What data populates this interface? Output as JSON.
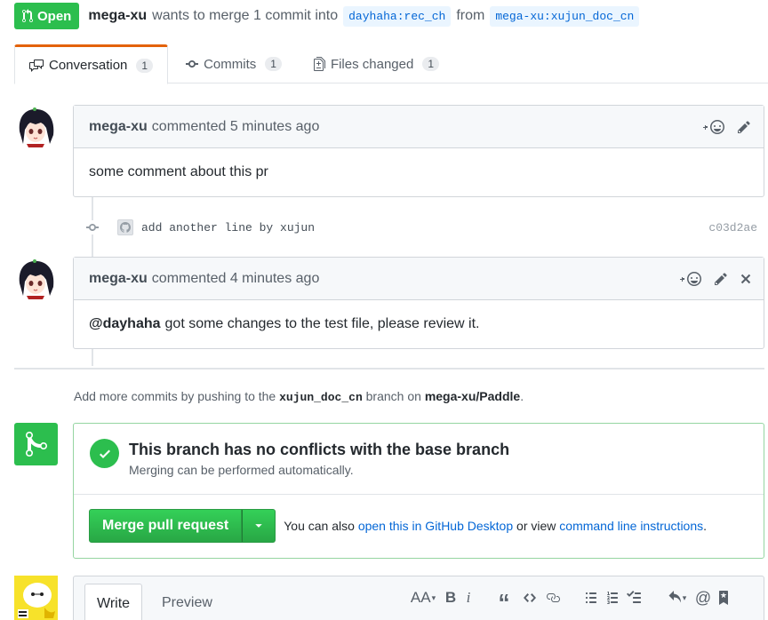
{
  "header": {
    "state_label": "Open",
    "author": "mega-xu",
    "action_text": "wants to merge 1 commit into",
    "base_branch": "dayhaha:rec_ch",
    "from_text": "from",
    "head_branch": "mega-xu:xujun_doc_cn"
  },
  "tabs": [
    {
      "label": "Conversation",
      "count": "1",
      "icon": "comment-discussion-icon"
    },
    {
      "label": "Commits",
      "count": "1",
      "icon": "git-commit-icon"
    },
    {
      "label": "Files changed",
      "count": "1",
      "icon": "diff-icon"
    }
  ],
  "comments": [
    {
      "author": "mega-xu",
      "meta": "commented 5 minutes ago",
      "body": "some comment about this pr"
    },
    {
      "author": "mega-xu",
      "meta": "commented 4 minutes ago",
      "mention": "@dayhaha",
      "body": "got some changes to the test file, please review it."
    }
  ],
  "commit": {
    "message": "add another line by xujun",
    "sha": "c03d2ae"
  },
  "push_hint": {
    "prefix": "Add more commits by pushing to the",
    "branch": "xujun_doc_cn",
    "middle": "branch on",
    "repo": "mega-xu/Paddle",
    "suffix": "."
  },
  "merge": {
    "title": "This branch has no conflicts with the base branch",
    "subtitle": "Merging can be performed automatically.",
    "button_label": "Merge pull request",
    "alt_prefix": "You can also",
    "alt_link1": "open this in GitHub Desktop",
    "alt_middle": "or view",
    "alt_link2": "command line instructions",
    "alt_suffix": "."
  },
  "composer": {
    "write_tab": "Write",
    "preview_tab": "Preview",
    "tools": {
      "text_size": "AA",
      "bold": "B",
      "italic": "i",
      "quote": "“",
      "mention": "@"
    }
  },
  "colors": {
    "success": "#2cbe4e",
    "link": "#0366d6",
    "accent_tab": "#e36209"
  }
}
